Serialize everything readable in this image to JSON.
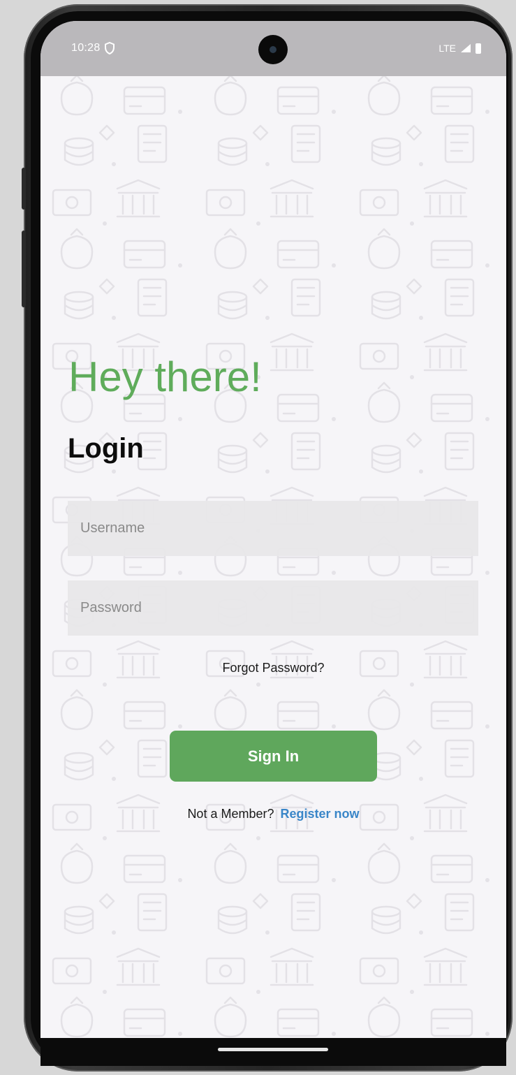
{
  "status_bar": {
    "time": "10:28",
    "network": "LTE"
  },
  "login": {
    "greeting": "Hey there!",
    "title": "Login",
    "username_placeholder": "Username",
    "password_placeholder": "Password",
    "forgot_password": "Forgot Password?",
    "sign_in_label": "Sign In",
    "not_member_text": "Not a Member?",
    "register_link": "Register now"
  },
  "colors": {
    "accent_green": "#5fa75c",
    "link_blue": "#3a86c8",
    "status_bar": "#bab8bb",
    "background": "#f6f5f8"
  },
  "icons": {
    "status_shield": "shield-icon",
    "signal": "signal-icon",
    "battery": "battery-icon"
  }
}
